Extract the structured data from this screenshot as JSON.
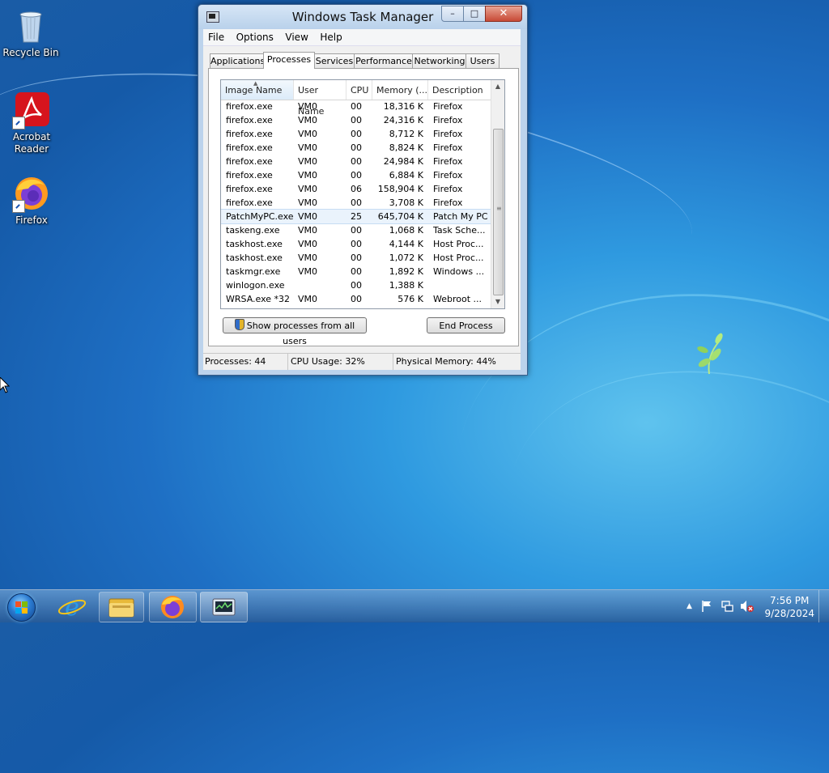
{
  "desktop": {
    "icons": [
      {
        "label": "Recycle Bin"
      },
      {
        "label": "Acrobat Reader"
      },
      {
        "label": "Firefox"
      }
    ]
  },
  "window": {
    "title": "Windows Task Manager",
    "controls": {
      "minimize": "–",
      "maximize": "□",
      "close": "✕"
    },
    "menu": [
      "File",
      "Options",
      "View",
      "Help"
    ],
    "tabs": [
      "Applications",
      "Processes",
      "Services",
      "Performance",
      "Networking",
      "Users"
    ],
    "active_tab": "Processes",
    "columns": [
      "Image Name",
      "User Name",
      "CPU",
      "Memory (...",
      "Description"
    ],
    "rows": [
      {
        "name": "firefox.exe",
        "user": "VM0",
        "cpu": "00",
        "mem": "18,316 K",
        "desc": "Firefox"
      },
      {
        "name": "firefox.exe",
        "user": "VM0",
        "cpu": "00",
        "mem": "24,316 K",
        "desc": "Firefox"
      },
      {
        "name": "firefox.exe",
        "user": "VM0",
        "cpu": "00",
        "mem": "8,712 K",
        "desc": "Firefox"
      },
      {
        "name": "firefox.exe",
        "user": "VM0",
        "cpu": "00",
        "mem": "8,824 K",
        "desc": "Firefox"
      },
      {
        "name": "firefox.exe",
        "user": "VM0",
        "cpu": "00",
        "mem": "24,984 K",
        "desc": "Firefox"
      },
      {
        "name": "firefox.exe",
        "user": "VM0",
        "cpu": "00",
        "mem": "6,884 K",
        "desc": "Firefox"
      },
      {
        "name": "firefox.exe",
        "user": "VM0",
        "cpu": "06",
        "mem": "158,904 K",
        "desc": "Firefox"
      },
      {
        "name": "firefox.exe",
        "user": "VM0",
        "cpu": "00",
        "mem": "3,708 K",
        "desc": "Firefox"
      },
      {
        "name": "PatchMyPC.exe",
        "user": "VM0",
        "cpu": "25",
        "mem": "645,704 K",
        "desc": "Patch My PC"
      },
      {
        "name": "taskeng.exe",
        "user": "VM0",
        "cpu": "00",
        "mem": "1,068 K",
        "desc": "Task Sche..."
      },
      {
        "name": "taskhost.exe",
        "user": "VM0",
        "cpu": "00",
        "mem": "4,144 K",
        "desc": "Host Proc..."
      },
      {
        "name": "taskhost.exe",
        "user": "VM0",
        "cpu": "00",
        "mem": "1,072 K",
        "desc": "Host Proc..."
      },
      {
        "name": "taskmgr.exe",
        "user": "VM0",
        "cpu": "00",
        "mem": "1,892 K",
        "desc": "Windows ..."
      },
      {
        "name": "winlogon.exe",
        "user": "",
        "cpu": "00",
        "mem": "1,388 K",
        "desc": ""
      },
      {
        "name": "WRSA.exe *32",
        "user": "VM0",
        "cpu": "00",
        "mem": "576 K",
        "desc": "Webroot ..."
      }
    ],
    "selected_row": 8,
    "buttons": {
      "show_all": "Show processes from all users",
      "end_process": "End Process"
    },
    "status": {
      "processes": "Processes: 44",
      "cpu": "CPU Usage: 32%",
      "memory": "Physical Memory: 44%"
    }
  },
  "taskbar": {
    "pinned": [
      "start-button",
      "internet-explorer",
      "file-explorer",
      "firefox",
      "task-manager"
    ],
    "clock": {
      "time": "7:56 PM",
      "date": "9/28/2024"
    },
    "tray_icons": [
      "show-hidden-icons",
      "action-center-flag-icon",
      "network-icon",
      "volume-muted-icon"
    ]
  },
  "colors": {
    "selection": "#eaf3fc",
    "close_button": "#c74a36",
    "desktop": "#1e6fc4"
  }
}
